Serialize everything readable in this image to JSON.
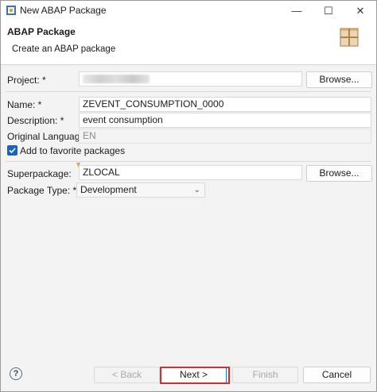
{
  "window": {
    "title": "New ABAP Package"
  },
  "header": {
    "title": "ABAP Package",
    "subtitle": "Create an ABAP package"
  },
  "form": {
    "project_label": "Project: *",
    "browse_label": "Browse...",
    "name_label": "Name: *",
    "name_value": "ZEVENT_CONSUMPTION_0000",
    "description_label": "Description: *",
    "description_value": "event consumption",
    "original_language_label": "Original Language:",
    "original_language_value": "EN",
    "favorite_label": "Add to favorite packages",
    "superpackage_label": "Superpackage:",
    "superpackage_value": "ZLOCAL",
    "superpackage_browse": "Browse...",
    "package_type_label": "Package Type: *",
    "package_type_value": "Development"
  },
  "footer": {
    "help": "?",
    "back_label": "< Back",
    "next_label": "Next >",
    "finish_label": "Finish",
    "cancel_label": "Cancel"
  },
  "colors": {
    "accent": "#1565c0",
    "highlight": "#d62e2e"
  }
}
